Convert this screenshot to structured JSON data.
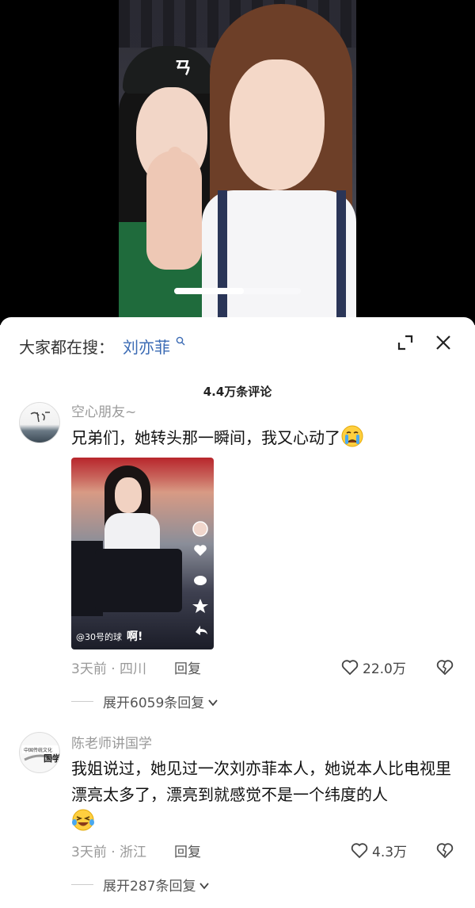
{
  "video": {
    "cap_logo": "ㄢ",
    "progress": 0.55
  },
  "search": {
    "prefix": "大家都在搜：",
    "term": "刘亦菲"
  },
  "comments_header": "4.4万条评论",
  "comments": [
    {
      "username": "空心朋友~",
      "text": "兄弟们，她转头那一瞬间，我又心动了",
      "emoji": "crying-face",
      "time_location": "3天前 · 四川",
      "reply_label": "回复",
      "likes": "22.0万",
      "expand_label": "展开6059条回复",
      "image_caption": "@30号的球",
      "image_caption_bold": "啊!"
    },
    {
      "username": "陈老师讲国学",
      "text": "我姐说过，她见过一次刘亦菲本人，她说本人比电视里漂亮太多了，漂亮到就感觉不是一个纬度的人",
      "emoji": "laughing-tears-face",
      "time_location": "3天前 · 浙江",
      "reply_label": "回复",
      "likes": "4.3万",
      "expand_label": "展开287条回复"
    }
  ],
  "colors": {
    "search_term": "#3a6ab4",
    "meta_gray": "#999999",
    "text_dark": "#111111"
  }
}
